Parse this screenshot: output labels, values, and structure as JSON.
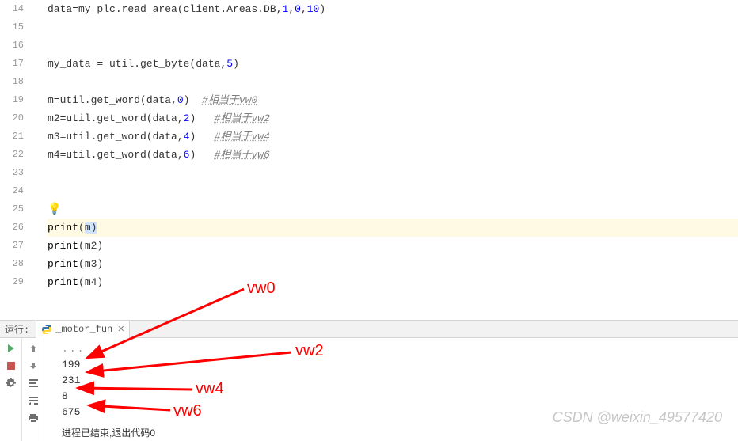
{
  "gutter": [
    "14",
    "15",
    "16",
    "17",
    "18",
    "19",
    "20",
    "21",
    "22",
    "23",
    "24",
    "25",
    "26",
    "27",
    "28",
    "29"
  ],
  "code": {
    "l14_a": "data=my_plc.read_area(client.Areas.DB,",
    "l14_n1": "1",
    "l14_c": ",",
    "l14_n2": "0",
    "l14_c2": ",",
    "l14_n3": "10",
    "l14_b": ")",
    "l17_a": "my_data = util.get_byte(data,",
    "l17_n": "5",
    "l17_b": ")",
    "l19_a": "m=util.get_word(data,",
    "l19_n": "0",
    "l19_b": ")  ",
    "l19_cmt": "#相当于vw0",
    "l20_a": "m2=util.get_word(data,",
    "l20_n": "2",
    "l20_b": ")   ",
    "l20_cmt": "#相当于vw2",
    "l21_a": "m3=util.get_word(data,",
    "l21_n": "4",
    "l21_b": ")   ",
    "l21_cmt": "#相当于vw4",
    "l22_a": "m4=util.get_word(data,",
    "l22_n": "6",
    "l22_b": ")   ",
    "l22_cmt": "#相当于vw6",
    "l26_a": "print",
    "l26_b": "(",
    "l26_v": "m",
    "l26_c": ")",
    "l27_a": "print",
    "l27_b": "(m2)",
    "l28_a": "print",
    "l28_b": "(m3)",
    "l29_a": "print",
    "l29_b": "(m4)"
  },
  "run": {
    "label": "运行:",
    "tab_name": "_motor_fun",
    "truncated": "...",
    "out1": "199",
    "out2": "231",
    "out3": "8",
    "out4": "675",
    "process_end": "进程已结束,退出代码0"
  },
  "annotations": {
    "vw0": "vw0",
    "vw2": "vw2",
    "vw4": "vw4",
    "vw6": "vw6"
  },
  "watermark": "CSDN @weixin_49577420"
}
